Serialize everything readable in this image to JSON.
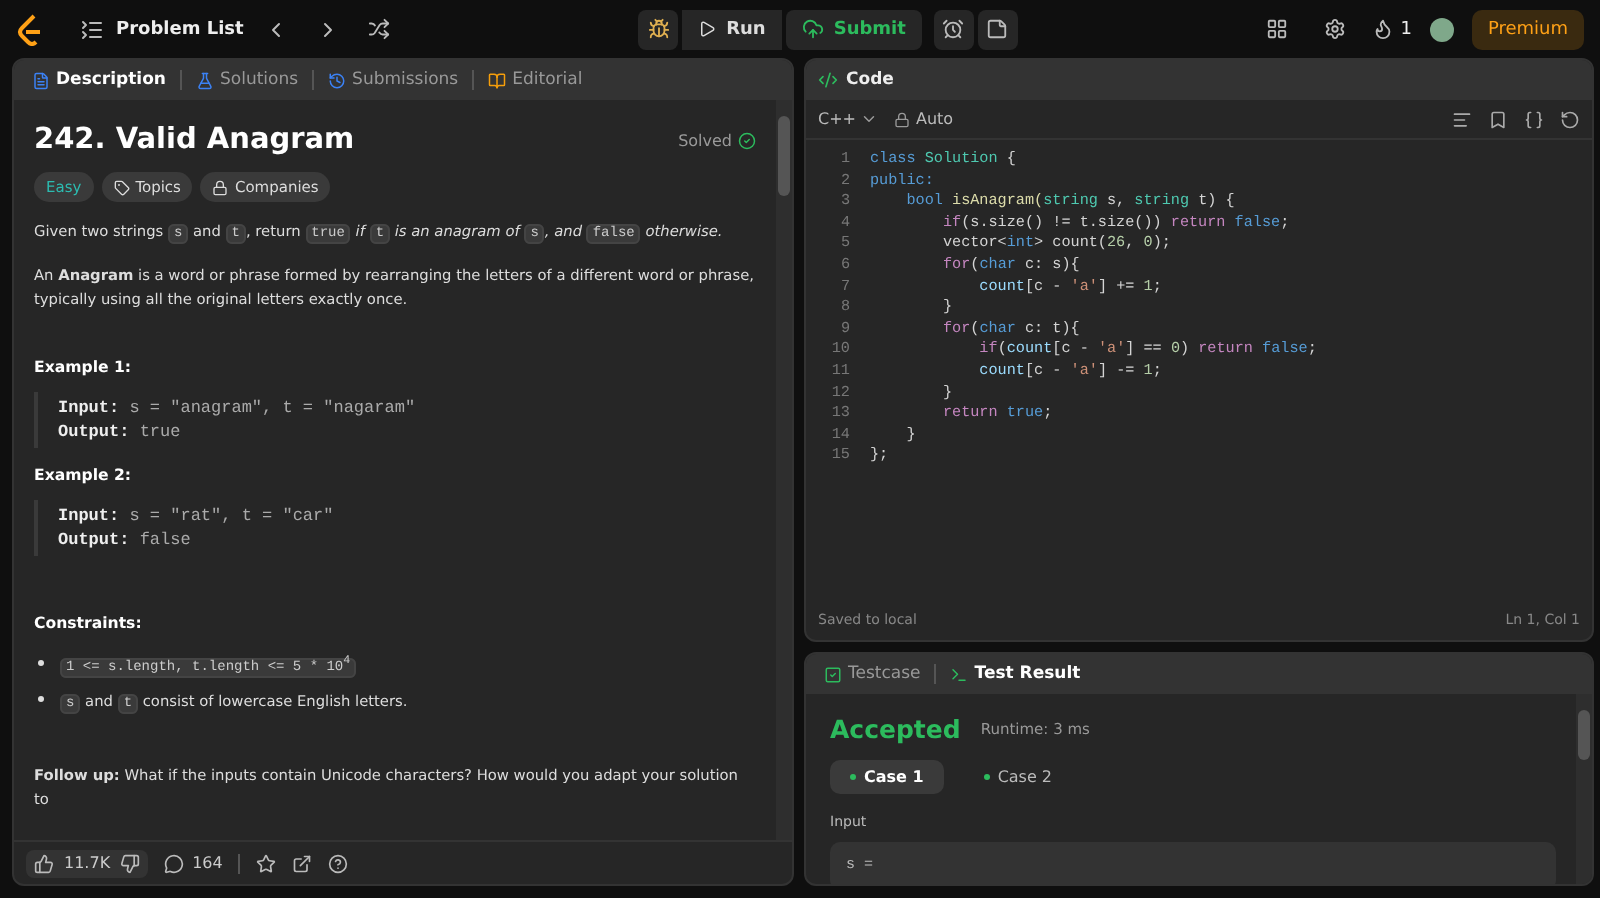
{
  "topbar": {
    "title": "Problem List",
    "run": "Run",
    "submit": "Submit",
    "streak": "1",
    "premium": "Premium"
  },
  "left_tabs": [
    {
      "label": "Description",
      "selected": true,
      "color": "#3b82f6"
    },
    {
      "label": "Solutions",
      "selected": false,
      "color": "#3b82f6"
    },
    {
      "label": "Submissions",
      "selected": false,
      "color": "#3b82f6"
    },
    {
      "label": "Editorial",
      "selected": false,
      "color": "#f59e0b"
    }
  ],
  "problem": {
    "title": "242. Valid Anagram",
    "status": "Solved",
    "solved": true,
    "difficulty": "Easy",
    "tags": [
      "Topics",
      "Companies"
    ],
    "statement": [
      {
        "kind": "plain",
        "text": "Given two strings "
      },
      {
        "kind": "code",
        "text": "s"
      },
      {
        "kind": "plain",
        "text": " and "
      },
      {
        "kind": "code",
        "text": "t"
      },
      {
        "kind": "plain",
        "text": ", return "
      },
      {
        "kind": "code",
        "text": "true"
      },
      {
        "kind": "italic",
        "text": " if "
      },
      {
        "kind": "code",
        "text": "t"
      },
      {
        "kind": "italic",
        "text": " is an anagram of "
      },
      {
        "kind": "code",
        "text": "s"
      },
      {
        "kind": "italic",
        "text": ", and "
      },
      {
        "kind": "code",
        "text": "false"
      },
      {
        "kind": "italic",
        "text": " otherwise."
      }
    ],
    "definition": "An **Anagram** is a word or phrase formed by rearranging the letters of a different word or phrase, typically using all the original letters exactly once.",
    "examples": [
      {
        "heading": "Example 1:",
        "input_label": "Input:",
        "input": "s = \"anagram\", t = \"nagaram\"",
        "output_label": "Output:",
        "output": "true"
      },
      {
        "heading": "Example 2:",
        "input_label": "Input:",
        "input": "s = \"rat\", t = \"car\"",
        "output_label": "Output:",
        "output": "false"
      }
    ],
    "constraints_heading": "Constraints:",
    "constraints": [
      [
        {
          "kind": "code",
          "text": "1 <= s.length, t.length <= 5 * 10$^{4}$"
        }
      ],
      [
        {
          "kind": "code",
          "text": "s"
        },
        {
          "kind": "plain",
          "text": " and "
        },
        {
          "kind": "code",
          "text": "t"
        },
        {
          "kind": "plain",
          "text": " consist of lowercase English letters."
        }
      ]
    ],
    "follow_up": "**Follow up:** What if the inputs contain Unicode characters? How would you adapt your solution to"
  },
  "footer": {
    "likes": "11.7K",
    "comments": "164"
  },
  "code_panel": {
    "title": "Code",
    "language": "C++",
    "mode": "Auto",
    "saved": "Saved to local",
    "cursor": "Ln 1, Col 1",
    "lines": [
      {
        "n": "1",
        "tokens": [
          {
            "text": "class ",
            "kind": "keyword"
          },
          {
            "text": "Solution ",
            "kind": "type"
          },
          {
            "text": "{",
            "kind": "plain"
          }
        ]
      },
      {
        "n": "2",
        "tokens": [
          {
            "text": "public:",
            "kind": "keyword"
          }
        ]
      },
      {
        "n": "3",
        "tokens": [
          {
            "text": "    bool ",
            "kind": "keyword"
          },
          {
            "text": "isAnagram(",
            "kind": "function"
          },
          {
            "text": "string ",
            "kind": "type"
          },
          {
            "text": "s, ",
            "kind": "plain"
          },
          {
            "text": "string ",
            "kind": "type"
          },
          {
            "text": "t) {",
            "kind": "plain"
          }
        ]
      },
      {
        "n": "4",
        "tokens": [
          {
            "text": "        if",
            "kind": "control"
          },
          {
            "text": "(s.size() != t.size()) ",
            "kind": "plain"
          },
          {
            "text": "return ",
            "kind": "control"
          },
          {
            "text": "false",
            "kind": "keyword"
          },
          {
            "text": ";",
            "kind": "plain"
          }
        ]
      },
      {
        "n": "5",
        "tokens": [
          {
            "text": "        vector<",
            "kind": "plain"
          },
          {
            "text": "int",
            "kind": "keyword"
          },
          {
            "text": "> count(",
            "kind": "plain"
          },
          {
            "text": "26",
            "kind": "number"
          },
          {
            "text": ", ",
            "kind": "plain"
          },
          {
            "text": "0",
            "kind": "number"
          },
          {
            "text": ");",
            "kind": "plain"
          }
        ]
      },
      {
        "n": "6",
        "tokens": [
          {
            "text": "        for",
            "kind": "control"
          },
          {
            "text": "(",
            "kind": "plain"
          },
          {
            "text": "char ",
            "kind": "keyword"
          },
          {
            "text": "c: s){",
            "kind": "plain"
          }
        ]
      },
      {
        "n": "7",
        "tokens": [
          {
            "text": "            count",
            "kind": "variable"
          },
          {
            "text": "[c - ",
            "kind": "plain"
          },
          {
            "text": "'a'",
            "kind": "string"
          },
          {
            "text": "] += ",
            "kind": "plain"
          },
          {
            "text": "1",
            "kind": "number"
          },
          {
            "text": ";",
            "kind": "plain"
          }
        ]
      },
      {
        "n": "8",
        "tokens": [
          {
            "text": "        }",
            "kind": "plain"
          }
        ]
      },
      {
        "n": "9",
        "tokens": [
          {
            "text": "        for",
            "kind": "control"
          },
          {
            "text": "(",
            "kind": "plain"
          },
          {
            "text": "char ",
            "kind": "keyword"
          },
          {
            "text": "c: t){",
            "kind": "plain"
          }
        ]
      },
      {
        "n": "10",
        "tokens": [
          {
            "text": "            if",
            "kind": "control"
          },
          {
            "text": "(",
            "kind": "plain"
          },
          {
            "text": "count",
            "kind": "variable"
          },
          {
            "text": "[c - ",
            "kind": "plain"
          },
          {
            "text": "'a'",
            "kind": "string"
          },
          {
            "text": "] == ",
            "kind": "plain"
          },
          {
            "text": "0",
            "kind": "number"
          },
          {
            "text": ") ",
            "kind": "plain"
          },
          {
            "text": "return ",
            "kind": "control"
          },
          {
            "text": "false",
            "kind": "keyword"
          },
          {
            "text": ";",
            "kind": "plain"
          }
        ]
      },
      {
        "n": "11",
        "tokens": [
          {
            "text": "            count",
            "kind": "variable"
          },
          {
            "text": "[c - ",
            "kind": "plain"
          },
          {
            "text": "'a'",
            "kind": "string"
          },
          {
            "text": "] -= ",
            "kind": "plain"
          },
          {
            "text": "1",
            "kind": "number"
          },
          {
            "text": ";",
            "kind": "plain"
          }
        ]
      },
      {
        "n": "12",
        "tokens": [
          {
            "text": "        }",
            "kind": "plain"
          }
        ]
      },
      {
        "n": "13",
        "tokens": [
          {
            "text": "        return ",
            "kind": "control"
          },
          {
            "text": "true",
            "kind": "keyword"
          },
          {
            "text": ";",
            "kind": "plain"
          }
        ]
      },
      {
        "n": "14",
        "tokens": [
          {
            "text": "    }",
            "kind": "plain"
          }
        ]
      },
      {
        "n": "15",
        "tokens": [
          {
            "text": "};",
            "kind": "plain"
          }
        ]
      }
    ]
  },
  "result_tabs": [
    {
      "label": "Testcase",
      "selected": false
    },
    {
      "label": "Test Result",
      "selected": true
    }
  ],
  "result": {
    "verdict": "Accepted",
    "runtime": "Runtime: 3 ms",
    "cases": [
      {
        "label": "Case 1",
        "selected": true
      },
      {
        "label": "Case 2",
        "selected": false
      }
    ],
    "input_label": "Input",
    "input_value": "s ="
  }
}
